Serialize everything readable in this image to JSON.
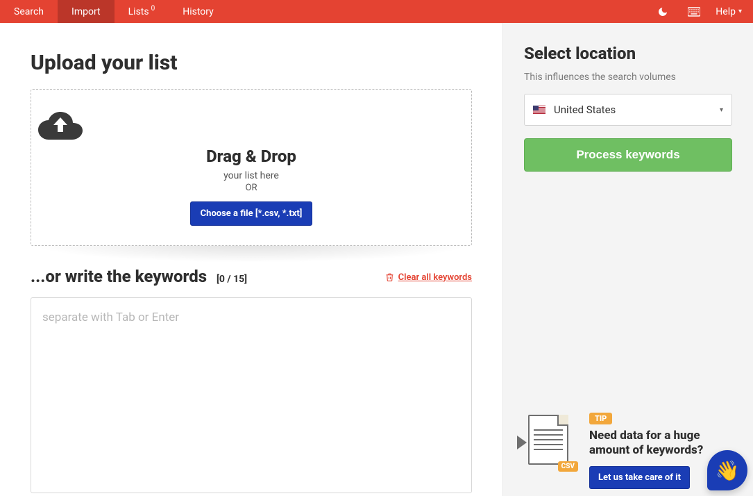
{
  "nav": {
    "items": [
      {
        "label": "Search"
      },
      {
        "label": "Import"
      },
      {
        "label": "Lists",
        "badge": "0"
      },
      {
        "label": "History"
      }
    ],
    "help_label": "Help"
  },
  "main": {
    "upload_heading": "Upload your list",
    "drop_title": "Drag & Drop",
    "drop_subtitle": "your list here",
    "drop_or": "OR",
    "choose_file_label": "Choose a file [*.csv, *.txt]",
    "write_heading": "...or write the keywords",
    "counter": "[0 / 15]",
    "clear_label": "Clear all keywords",
    "textarea_placeholder": "separate with Tab or Enter"
  },
  "sidebar": {
    "location_heading": "Select location",
    "location_sub": "This influences the search volumes",
    "selected_location": "United States",
    "process_label": "Process keywords"
  },
  "tip": {
    "badge": "TIP",
    "heading": "Need data for a huge amount of keywords?",
    "cta": "Let us take care of it",
    "csv_label": "CSV"
  }
}
